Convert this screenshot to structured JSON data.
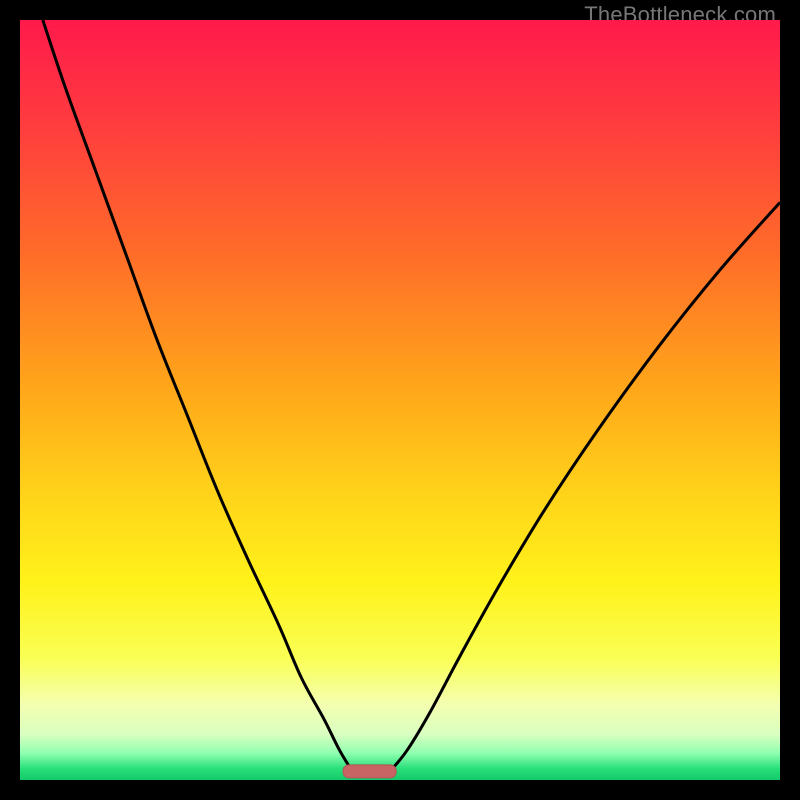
{
  "watermark": "TheBottleneck.com",
  "colors": {
    "frame": "#000000",
    "curve": "#000000",
    "marker_fill": "#c96464",
    "marker_stroke": "#b25555",
    "gradient_stops": [
      {
        "offset": 0.0,
        "color": "#ff1a4b"
      },
      {
        "offset": 0.13,
        "color": "#ff3a3f"
      },
      {
        "offset": 0.3,
        "color": "#ff6a2a"
      },
      {
        "offset": 0.48,
        "color": "#ffa51a"
      },
      {
        "offset": 0.62,
        "color": "#ffd21a"
      },
      {
        "offset": 0.74,
        "color": "#fff21a"
      },
      {
        "offset": 0.84,
        "color": "#faff55"
      },
      {
        "offset": 0.9,
        "color": "#f4ffb0"
      },
      {
        "offset": 0.94,
        "color": "#d9ffc0"
      },
      {
        "offset": 0.965,
        "color": "#8fffb0"
      },
      {
        "offset": 0.985,
        "color": "#28e07a"
      },
      {
        "offset": 1.0,
        "color": "#14c96a"
      }
    ]
  },
  "chart_data": {
    "type": "line",
    "title": "",
    "xlabel": "",
    "ylabel": "",
    "xlim": [
      0,
      100
    ],
    "ylim": [
      0,
      100
    ],
    "grid": false,
    "series": [
      {
        "name": "left-curve",
        "x": [
          3,
          6,
          10,
          14,
          18,
          22,
          26,
          30,
          34,
          37,
          40,
          42,
          43.5
        ],
        "y": [
          100,
          91,
          80,
          69,
          58,
          48,
          38,
          29,
          20.5,
          13.5,
          8,
          4,
          1.5
        ]
      },
      {
        "name": "right-curve",
        "x": [
          49,
          51,
          54,
          58,
          63,
          69,
          76,
          84,
          92,
          100
        ],
        "y": [
          1.5,
          4,
          9,
          16.5,
          25.5,
          35.5,
          46,
          57,
          67,
          76
        ]
      }
    ],
    "marker": {
      "x_center": 46,
      "width": 7,
      "y": 1.2
    }
  }
}
